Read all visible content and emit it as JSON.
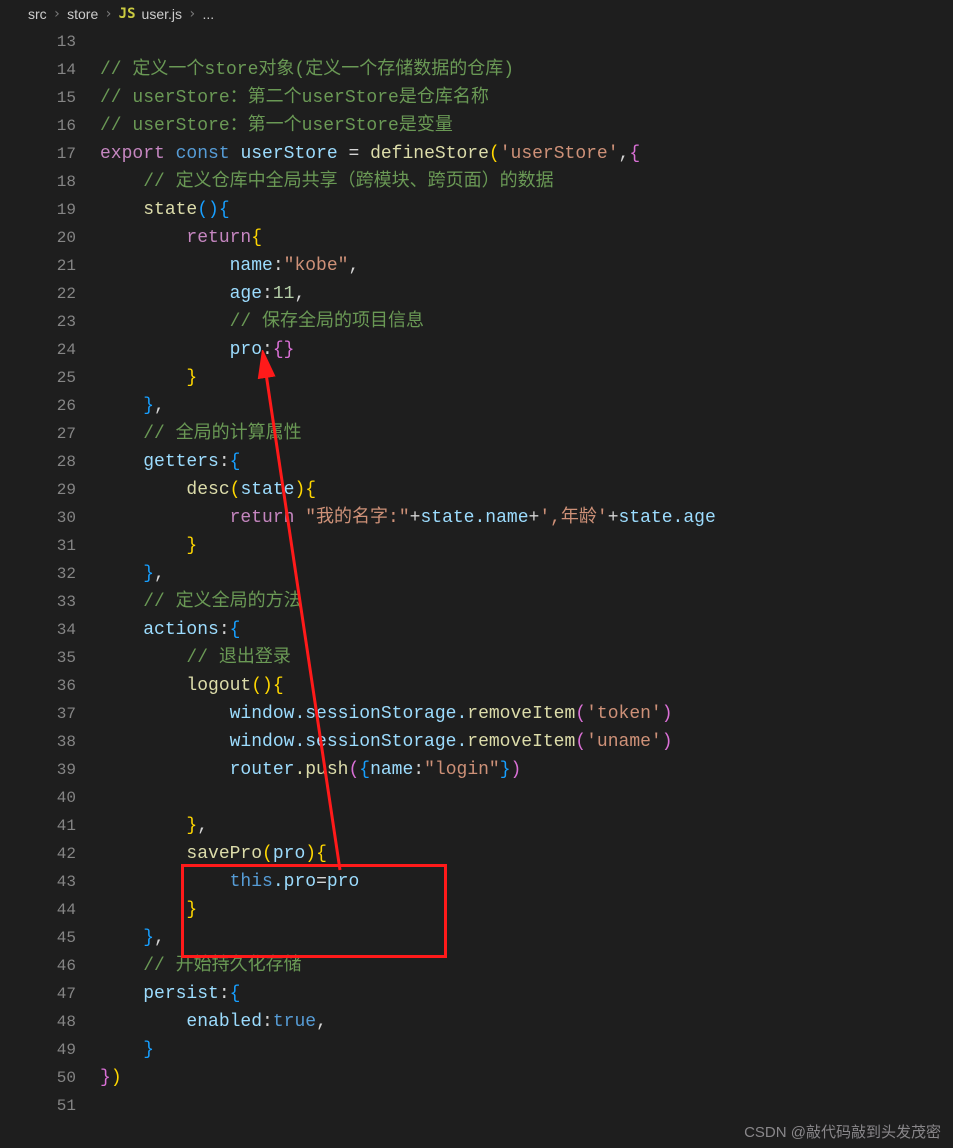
{
  "breadcrumbs": {
    "seg1": "src",
    "seg2": "store",
    "seg3_icon": "JS",
    "seg3": "user.js",
    "seg4": "..."
  },
  "lines": {
    "start": 13,
    "end": 51,
    "l14": "// 定义一个store对象(定义一个存储数据的仓库)",
    "l15": "// userStore：第二个userStore是仓库名称",
    "l16": "// userStore：第一个userStore是变量",
    "l17_export": "export",
    "l17_const": "const",
    "l17_var": "userStore",
    "l17_eq": " = ",
    "l17_fn": "defineStore",
    "l17_str": "'userStore'",
    "l18": "// 定义仓库中全局共享（跨模块、跨页面）的数据",
    "l19_state": "state",
    "l20_return": "return",
    "l21_name": "name",
    "l21_v": "\"kobe\"",
    "l22_age": "age",
    "l22_v": "11",
    "l23": "// 保存全局的项目信息",
    "l24_pro": "pro",
    "l27": "// 全局的计算属性",
    "l28_getters": "getters",
    "l29_desc": "desc",
    "l29_state": "state",
    "l30_return": "return",
    "l30_str1": "\"我的名字:\"",
    "l30_plus": "+",
    "l30_state": "state",
    "l30_name": ".name",
    "l30_str2": "',年龄'",
    "l30_age": ".age",
    "l33": "// 定义全局的方法",
    "l34_actions": "actions",
    "l35": "// 退出登录",
    "l36_logout": "logout",
    "l37_window": "window",
    "l37_ss": ".sessionStorage.",
    "l37_ri": "removeItem",
    "l37_str": "'token'",
    "l38_window": "window",
    "l38_ss": ".sessionStorage.",
    "l38_ri": "removeItem",
    "l38_str": "'uname'",
    "l39_router": "router",
    "l39_push": ".push",
    "l39_name": "name",
    "l39_str": "\"login\"",
    "l42_savePro": "savePro",
    "l42_pro": "pro",
    "l43_this": "this",
    "l43_pro": ".pro",
    "l43_eq": "=",
    "l43_rhs": "pro",
    "l46": "// 开始持久化存储",
    "l47_persist": "persist",
    "l48_enabled": "enabled",
    "l48_true": "true"
  },
  "watermark": "CSDN @敲代码敲到头发茂密"
}
